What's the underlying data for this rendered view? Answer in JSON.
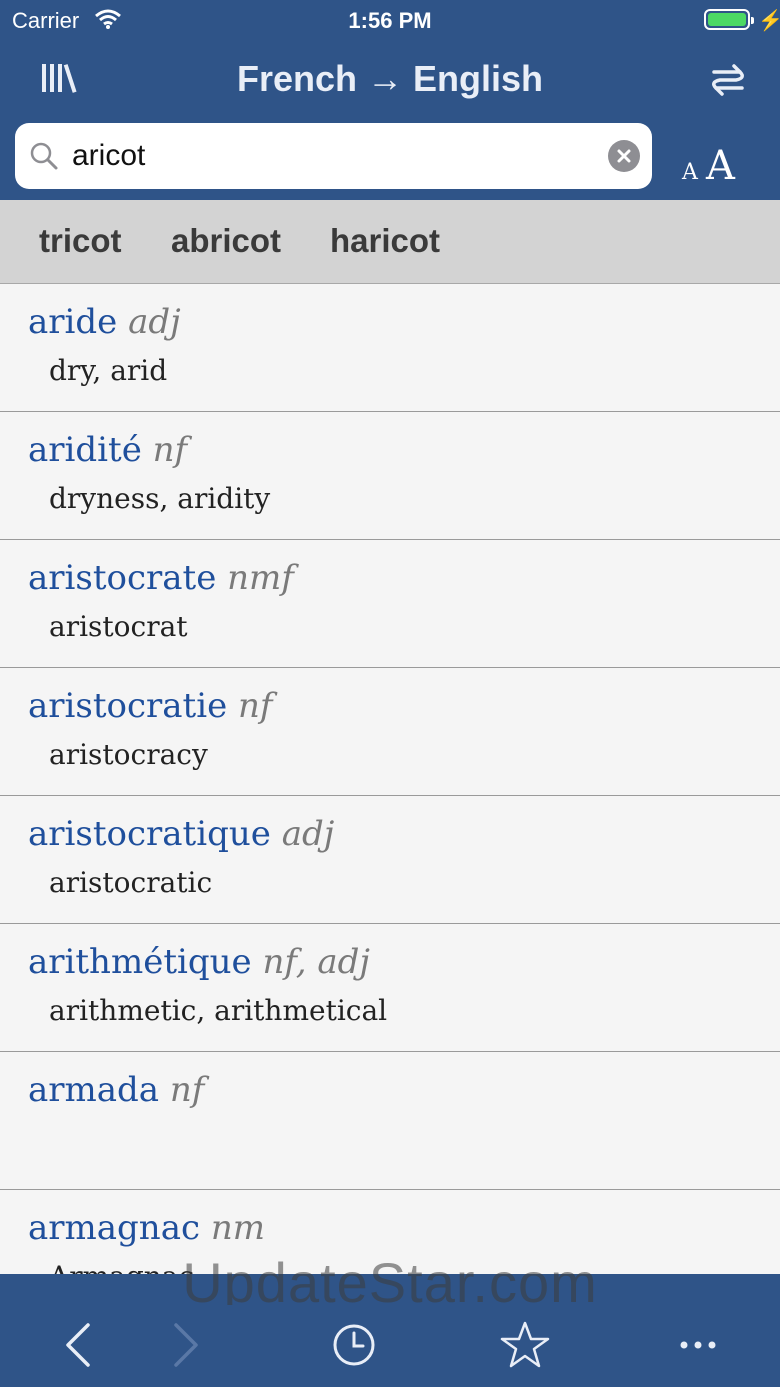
{
  "status": {
    "carrier": "Carrier",
    "time": "1:56 PM"
  },
  "nav": {
    "title": "French → English"
  },
  "search": {
    "value": "aricot",
    "placeholder": ""
  },
  "suggestions": [
    "tricot",
    "abricot",
    "haricot"
  ],
  "results": [
    {
      "word": "aride",
      "pos": "adj",
      "gloss": "dry, arid"
    },
    {
      "word": "aridité",
      "pos": "nf",
      "gloss": "dryness, aridity"
    },
    {
      "word": "aristocrate",
      "pos": "nmf",
      "gloss": "aristocrat"
    },
    {
      "word": "aristocratie",
      "pos": "nf",
      "gloss": "aristocracy"
    },
    {
      "word": "aristocratique",
      "pos": "adj",
      "gloss": "aristocratic"
    },
    {
      "word": "arithmétique",
      "pos": "nf, adj",
      "gloss": "arithmetic, arithmetical"
    },
    {
      "word": "armada",
      "pos": "nf",
      "gloss": ""
    },
    {
      "word": "armagnac",
      "pos": "nm",
      "gloss": "Armagnac"
    }
  ],
  "watermark": "UpdateStar.com",
  "colors": {
    "bar": "#2f5488",
    "headword": "#1f4f9c",
    "battery": "#4cd964"
  },
  "icons": [
    "library-icon",
    "swap-languages-icon",
    "search-icon",
    "clear-icon",
    "text-size-icon",
    "back-icon",
    "forward-icon",
    "history-icon",
    "favorites-icon",
    "more-icon"
  ]
}
